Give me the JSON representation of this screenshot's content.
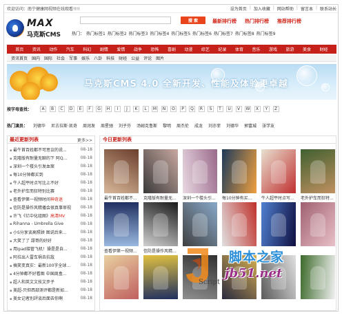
{
  "topbar": {
    "welcome": "欢迎访问：南宁健康网视频在线观看!!!!",
    "links": [
      "设为首页",
      "加入收藏",
      "网站帮助",
      "留言本",
      "联系站长"
    ]
  },
  "header": {
    "logo_text": "MAX",
    "logo_sub": "马克斯CMS",
    "search_placeholder": "",
    "search_button": "搜 索",
    "rank_links": [
      "最新排行榜",
      "热门排行榜",
      "推荐排行榜"
    ],
    "hot_tags_label": "热门：",
    "hot_tags": [
      "热门标签1",
      "热门标签2",
      "热门标签3",
      "热门标签4",
      "热门标签5",
      "热门标签6",
      "热门标签7",
      "热门标签8",
      "热门标签9"
    ]
  },
  "nav": {
    "items": [
      "首页",
      "资讯",
      "动作",
      "汽车",
      "科幻",
      "剧情",
      "爱情",
      "战争",
      "恐怖",
      "喜剧",
      "动漫",
      "综艺",
      "纪录",
      "体育",
      "音乐",
      "游戏",
      "旅游",
      "美食",
      "财经"
    ],
    "sub_items": [
      "资讯首页",
      "国内",
      "国际",
      "社会",
      "军事",
      "娱乐",
      "八卦",
      "科技",
      "财经",
      "公益",
      "评论",
      "图片"
    ]
  },
  "banner": {
    "text": "马克斯CMS 4.0 全新开发、性能及体验更卓越"
  },
  "letter_index": {
    "label": "按字母查找：",
    "letters": [
      "A",
      "B",
      "C",
      "D",
      "E",
      "F",
      "G",
      "H",
      "I",
      "J",
      "K",
      "L",
      "M",
      "N",
      "O",
      "P",
      "Q",
      "R",
      "S",
      "T",
      "U",
      "V",
      "W",
      "X",
      "Y",
      "Z"
    ]
  },
  "hot_actors": {
    "label": "热门演员：",
    "names": [
      "刘德华",
      "尼古拉斯·凯奇",
      "周润发",
      "周星驰",
      "刘子芬",
      "汤姆克鲁斯",
      "黎明",
      "周杰伦",
      "成龙",
      "刘亦菲",
      "刘德华",
      "郭富城",
      "张学友"
    ]
  },
  "latest_list": {
    "title": "最近更新列表",
    "more": "更多>>",
    "rows": [
      {
        "name": "最牛首百姓都不可思议的说...",
        "hl": "",
        "date": "08-18"
      },
      {
        "name": "克隆版有耐量无聊的下 阿Q...",
        "hl": "",
        "date": "08-18"
      },
      {
        "name": "深圳一个楼头引发血案",
        "hl": "",
        "date": "08-18"
      },
      {
        "name": "每10分钟都买到",
        "hl": "",
        "date": "08-18"
      },
      {
        "name": "牛人超平时点写比上不好",
        "hl": "",
        "date": "08-18"
      },
      {
        "name": "老外护车而狂特别比赛",
        "hl": "",
        "date": "08-18"
      },
      {
        "name": "查看伊第一视频时间",
        "hl": "神奇迷",
        "date": "08-18"
      },
      {
        "name": "信防是操作风精播会很真事审视",
        "hl": "",
        "date": "08-18"
      },
      {
        "name": "许飞《亿中化组图》",
        "hl": "高清MV",
        "date": "08-18"
      },
      {
        "name": "Rihanna - Umbrella Give",
        "hl": "",
        "date": "08-18"
      },
      {
        "name": "小S分享谈高照顾 图说后来...",
        "hl": "",
        "date": "08-18"
      },
      {
        "name": "大笑了了 甜哥的好好",
        "hl": "",
        "date": "08-18"
      },
      {
        "name": "用ipad接管飞机！操是是自...",
        "hl": "",
        "date": "08-18"
      },
      {
        "name": "阿拉出人雷车祸去抗敌",
        "hl": "",
        "date": "08-18"
      },
      {
        "name": "搞笑变真实：最新100字全球...",
        "hl": "",
        "date": "08-18"
      },
      {
        "name": "4分钟都不好看图 中国周盒...",
        "hl": "",
        "date": "08-18"
      },
      {
        "name": "超人和英文文技文步子",
        "hl": "",
        "date": "08-18"
      },
      {
        "name": "美超-只但西部测评都是新如...",
        "hl": "",
        "date": "08-18"
      },
      {
        "name": "美女记者別評谈后面去你啊",
        "hl": "",
        "date": "08-18"
      }
    ]
  },
  "today_list": {
    "title": "今日更新列表",
    "cards": [
      {
        "caption": "最牛首百姓都不...",
        "icon": "video-thumbnail-1"
      },
      {
        "caption": "克隆版有耐量无...",
        "icon": "video-thumbnail-2"
      },
      {
        "caption": "深圳一个楼头引...",
        "icon": "video-thumbnail-3"
      },
      {
        "caption": "每10分钟有买...",
        "icon": "video-thumbnail-4"
      },
      {
        "caption": "牛人超平时点写...",
        "icon": "video-thumbnail-5"
      },
      {
        "caption": "老外护车而狂特...",
        "icon": "video-thumbnail-6"
      },
      {
        "caption": "查看伊第一视频...",
        "icon": "video-thumbnail-7"
      },
      {
        "caption": "信防是操作风精...",
        "icon": "video-thumbnail-8"
      },
      {
        "caption": "",
        "icon": "video-thumbnail-9"
      },
      {
        "caption": "",
        "icon": "video-thumbnail-10"
      },
      {
        "caption": "",
        "icon": "video-thumbnail-11"
      },
      {
        "caption": "",
        "icon": "video-thumbnail-12"
      },
      {
        "caption": "",
        "icon": "video-thumbnail-13"
      },
      {
        "caption": "",
        "icon": "video-thumbnail-14"
      },
      {
        "caption": "",
        "icon": "video-thumbnail-15"
      },
      {
        "caption": "",
        "icon": "video-thumbnail-16"
      },
      {
        "caption": "",
        "icon": "video-thumbnail-17"
      },
      {
        "caption": "",
        "icon": "video-thumbnail-18"
      }
    ]
  },
  "watermark": {
    "brand": "脚本之家",
    "url": "jb51.net",
    "script": "Script"
  },
  "colors": {
    "accent": "#c6201a",
    "link_red": "#d2261a",
    "watermark_blue": "#2c8fd8",
    "watermark_purple": "#9b2e86"
  }
}
